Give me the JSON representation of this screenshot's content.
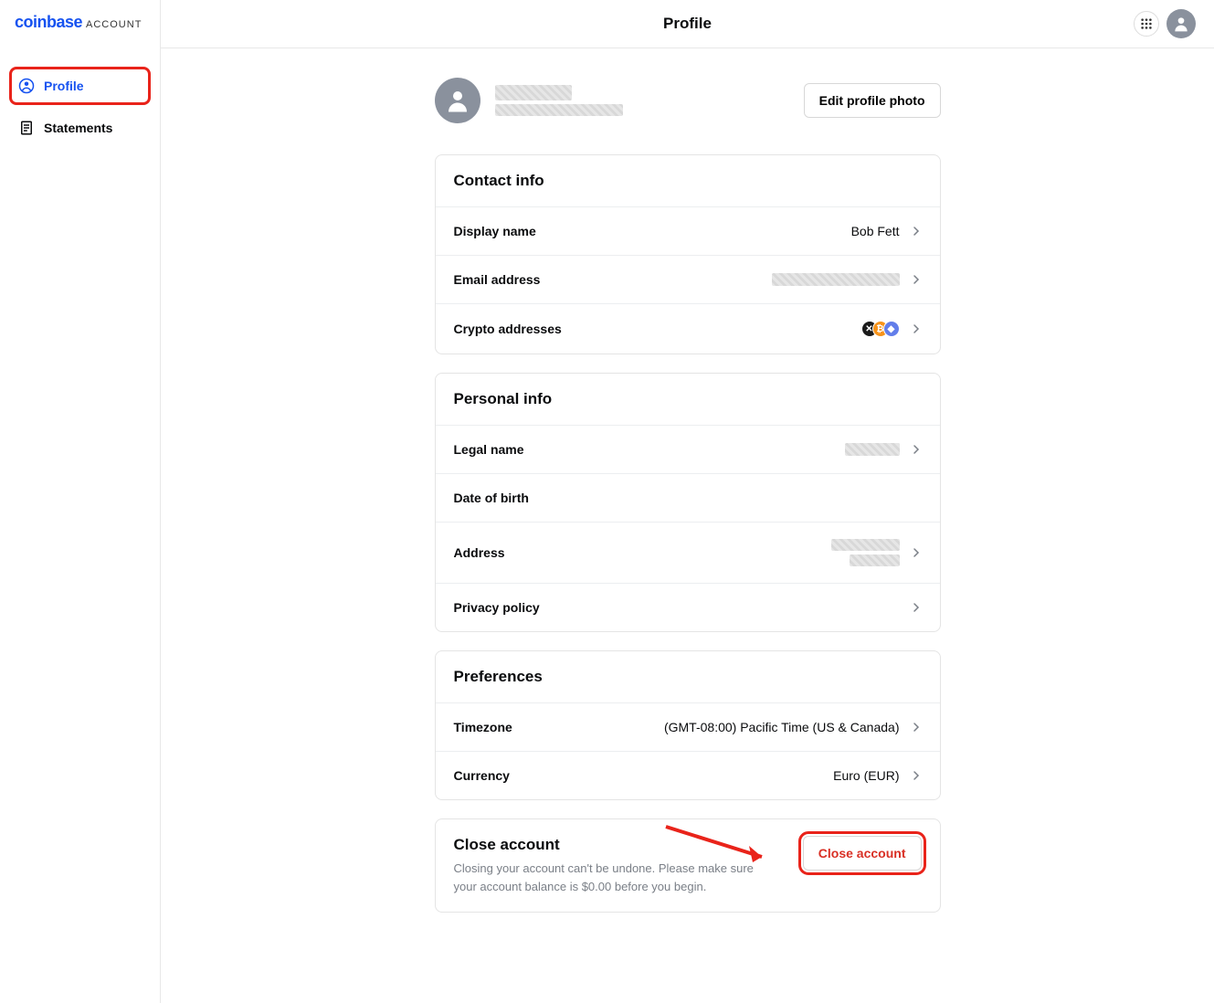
{
  "brand": {
    "main": "coinbase",
    "sub": "ACCOUNT"
  },
  "sidebar": {
    "items": [
      {
        "label": "Profile"
      },
      {
        "label": "Statements"
      }
    ]
  },
  "header": {
    "title": "Profile"
  },
  "profile": {
    "edit_photo_btn": "Edit profile photo"
  },
  "contact": {
    "title": "Contact info",
    "display_name_label": "Display name",
    "display_name_value": "Bob Fett",
    "email_label": "Email address",
    "crypto_label": "Crypto addresses"
  },
  "personal": {
    "title": "Personal info",
    "legal_name_label": "Legal name",
    "dob_label": "Date of birth",
    "address_label": "Address",
    "privacy_label": "Privacy policy"
  },
  "preferences": {
    "title": "Preferences",
    "timezone_label": "Timezone",
    "timezone_value": "(GMT-08:00) Pacific Time (US & Canada)",
    "currency_label": "Currency",
    "currency_value": "Euro (EUR)"
  },
  "close": {
    "title": "Close account",
    "description": "Closing your account can't be undone. Please make sure your account balance is $0.00 before you begin.",
    "button": "Close account"
  }
}
